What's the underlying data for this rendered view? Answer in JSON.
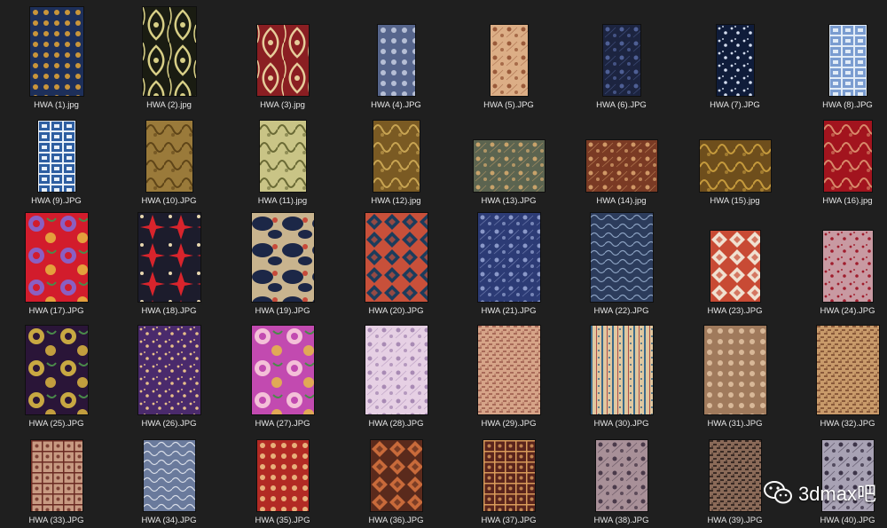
{
  "files": [
    {
      "name": "HWA (1).jpg",
      "pattern": "dots",
      "colors": [
        "#1d2f5a",
        "#c9953a"
      ]
    },
    {
      "name": "HWA (2).jpg",
      "pattern": "damask",
      "colors": [
        "#1a1c12",
        "#d8cf86"
      ]
    },
    {
      "name": "HWA (3).jpg",
      "pattern": "damask",
      "colors": [
        "#8a1e22",
        "#e6cc9a"
      ]
    },
    {
      "name": "HWA (4).JPG",
      "pattern": "dots",
      "colors": [
        "#56658c",
        "#b6bfd6"
      ]
    },
    {
      "name": "HWA (5).JPG",
      "pattern": "floral",
      "colors": [
        "#dcae86",
        "#9a5a3a"
      ]
    },
    {
      "name": "HWA (6).JPG",
      "pattern": "floral",
      "colors": [
        "#1c2440",
        "#4e5f95"
      ]
    },
    {
      "name": "HWA (7).JPG",
      "pattern": "scatter",
      "colors": [
        "#0f1c3a",
        "#d4ddef"
      ]
    },
    {
      "name": "HWA (8).JPG",
      "pattern": "blocks",
      "colors": [
        "#7a9cd0",
        "#e2ecf7"
      ]
    },
    {
      "name": "HWA (9).JPG",
      "pattern": "blocks",
      "colors": [
        "#2e5ea1",
        "#e8f0f9"
      ]
    },
    {
      "name": "HWA (10).JPG",
      "pattern": "swirl",
      "colors": [
        "#9a7a3a",
        "#5f4518"
      ]
    },
    {
      "name": "HWA (11).jpg",
      "pattern": "swirl",
      "colors": [
        "#c9c486",
        "#6a6a35"
      ]
    },
    {
      "name": "HWA (12).jpg",
      "pattern": "swirl",
      "colors": [
        "#7a5a23",
        "#c8a452"
      ]
    },
    {
      "name": "HWA (13).JPG",
      "pattern": "floral",
      "colors": [
        "#5b6450",
        "#c8a26a"
      ]
    },
    {
      "name": "HWA (14).jpg",
      "pattern": "floral",
      "colors": [
        "#7a3a24",
        "#d09866"
      ]
    },
    {
      "name": "HWA (15).jpg",
      "pattern": "swirl",
      "colors": [
        "#6e4e1c",
        "#c59a3c"
      ]
    },
    {
      "name": "HWA (16).jpg",
      "pattern": "swirl",
      "colors": [
        "#a2141e",
        "#d88a6a"
      ]
    },
    {
      "name": "HWA (17).JPG",
      "pattern": "bigfloral",
      "colors": [
        "#d21c2c",
        "#8a5fc2"
      ]
    },
    {
      "name": "HWA (18).JPG",
      "pattern": "leaves",
      "colors": [
        "#1c1c2c",
        "#d8242c"
      ]
    },
    {
      "name": "HWA (19).JPG",
      "pattern": "clouds",
      "colors": [
        "#1c2747",
        "#c9b48e"
      ]
    },
    {
      "name": "HWA (20).JPG",
      "pattern": "diamonds",
      "colors": [
        "#c8503a",
        "#1c3c5c"
      ]
    },
    {
      "name": "HWA (21).JPG",
      "pattern": "floral",
      "colors": [
        "#2c3b75",
        "#8a98c8"
      ]
    },
    {
      "name": "HWA (22).JPG",
      "pattern": "waves",
      "colors": [
        "#2c3c5c",
        "#8aa0c0"
      ]
    },
    {
      "name": "HWA (23).JPG",
      "pattern": "diamonds",
      "colors": [
        "#c84a34",
        "#f0e0d0"
      ]
    },
    {
      "name": "HWA (24).JPG",
      "pattern": "scatter",
      "colors": [
        "#c89aa2",
        "#a01c2c"
      ]
    },
    {
      "name": "HWA (25).JPG",
      "pattern": "bigfloral",
      "colors": [
        "#2a1538",
        "#c8a842"
      ]
    },
    {
      "name": "HWA (26).JPG",
      "pattern": "scatter",
      "colors": [
        "#4a2a6c",
        "#e8c08a"
      ]
    },
    {
      "name": "HWA (27).JPG",
      "pattern": "bigfloral",
      "colors": [
        "#c24ab0",
        "#f4c0d8"
      ]
    },
    {
      "name": "HWA (28).JPG",
      "pattern": "floral",
      "colors": [
        "#e6d0e4",
        "#a88ab4"
      ]
    },
    {
      "name": "HWA (29).JPG",
      "pattern": "weave",
      "colors": [
        "#d6a488",
        "#a86a58"
      ]
    },
    {
      "name": "HWA (30).JPG",
      "pattern": "stripes",
      "colors": [
        "#e0c8a0",
        "#3a6a8a"
      ]
    },
    {
      "name": "HWA (31).JPG",
      "pattern": "dots",
      "colors": [
        "#a07a5c",
        "#d8b898"
      ]
    },
    {
      "name": "HWA (32).JPG",
      "pattern": "weave",
      "colors": [
        "#c89a6a",
        "#8a5a3a"
      ]
    },
    {
      "name": "HWA (33).JPG",
      "pattern": "grid",
      "colors": [
        "#c89a82",
        "#6a2a22"
      ]
    },
    {
      "name": "HWA (34).JPG",
      "pattern": "waves",
      "colors": [
        "#6a7a9c",
        "#d8dde8"
      ]
    },
    {
      "name": "HWA (35).JPG",
      "pattern": "dots",
      "colors": [
        "#b22a24",
        "#e8b07a"
      ]
    },
    {
      "name": "HWA (36).JPG",
      "pattern": "diamonds",
      "colors": [
        "#5a2a1c",
        "#c86a3a"
      ]
    },
    {
      "name": "HWA (37).JPG",
      "pattern": "grid",
      "colors": [
        "#5a241c",
        "#d89a5a"
      ]
    },
    {
      "name": "HWA (38).JPG",
      "pattern": "floral",
      "colors": [
        "#a89098",
        "#4a3a4a"
      ]
    },
    {
      "name": "HWA (39).JPG",
      "pattern": "weave",
      "colors": [
        "#8a6a58",
        "#3a2a24"
      ]
    },
    {
      "name": "HWA (40).JPG",
      "pattern": "floral",
      "colors": [
        "#a8a2b4",
        "#3c3448"
      ]
    }
  ],
  "watermark": {
    "text": "3dmax吧",
    "icon": "wechat-icon"
  },
  "colors": {
    "background": "#1f1f1f",
    "label": "#e6e6e6"
  }
}
